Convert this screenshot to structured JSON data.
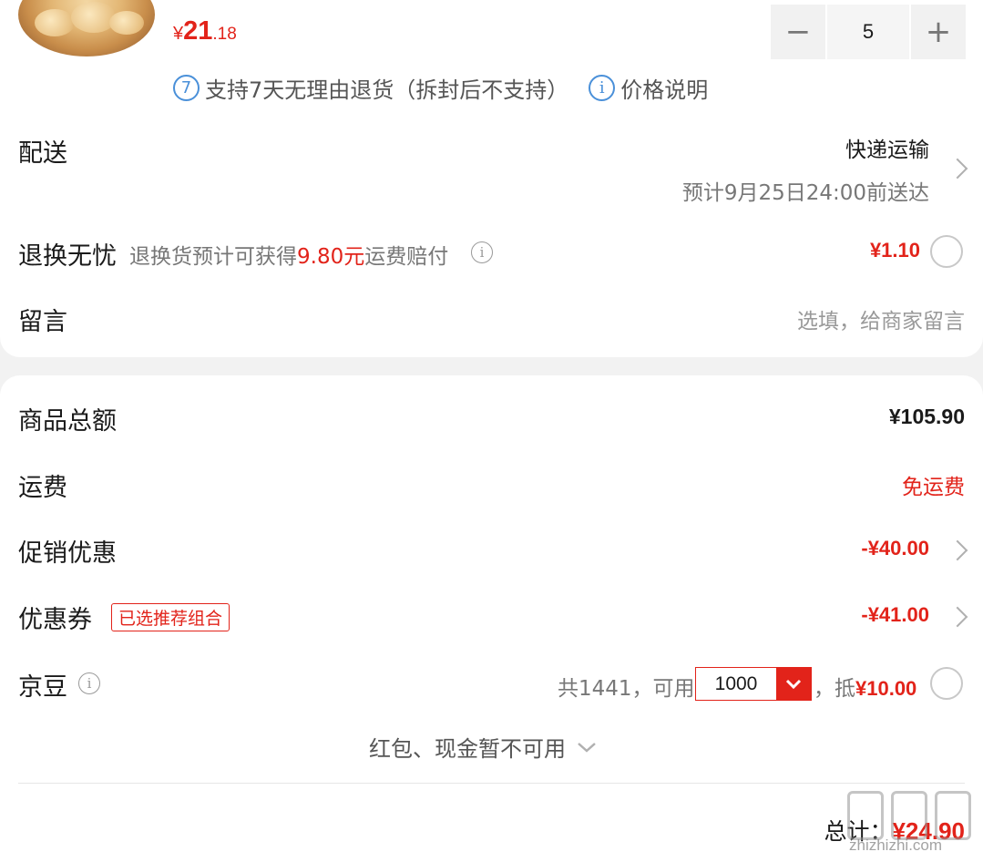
{
  "item": {
    "price_symbol": "¥",
    "price_int": "21",
    "price_dec": ".18",
    "quantity": "5",
    "minus_label": "−",
    "plus_label": "+",
    "return_policy_icon": "7",
    "return_policy": "支持7天无理由退货（拆封后不支持）",
    "price_info_label": "价格说明"
  },
  "delivery": {
    "label": "配送",
    "method": "快递运输",
    "eta": "预计9月25日24:00前送达"
  },
  "worry_free": {
    "label": "退换无忧",
    "desc_prefix": "退换货预计可获得",
    "desc_amount": "9.80元",
    "desc_suffix": "运费赔付",
    "price": "¥1.10"
  },
  "message": {
    "label": "留言",
    "placeholder": "选填，给商家留言"
  },
  "summary": {
    "goods_total_label": "商品总额",
    "goods_total": "¥105.90",
    "shipping_label": "运费",
    "shipping_value": "免运费",
    "promo_label": "促销优惠",
    "promo_value": "-¥40.00",
    "coupon_label": "优惠券",
    "coupon_tag": "已选推荐组合",
    "coupon_value": "-¥41.00",
    "jd_beans_label": "京豆",
    "jd_beans_prefix": "共1441，可用",
    "jd_beans_select": "1000",
    "jd_beans_deduct_prefix": "，抵",
    "jd_beans_deduct": "¥10.00",
    "unavailable_label": "红包、现金暂不可用"
  },
  "footer": {
    "total_label": "总计：",
    "total_value": "¥24.90",
    "watermark": "zhizhizhi.com"
  },
  "colors": {
    "accent_red": "#e2231a",
    "link_blue": "#4a90d9",
    "background": "#f2f2f2"
  },
  "icons": {
    "policy": "return-7day-icon",
    "price_info": "info-icon",
    "chevron": "chevron-right-icon",
    "radio": "radio-unchecked-icon",
    "dropdown": "chevron-down-icon"
  }
}
